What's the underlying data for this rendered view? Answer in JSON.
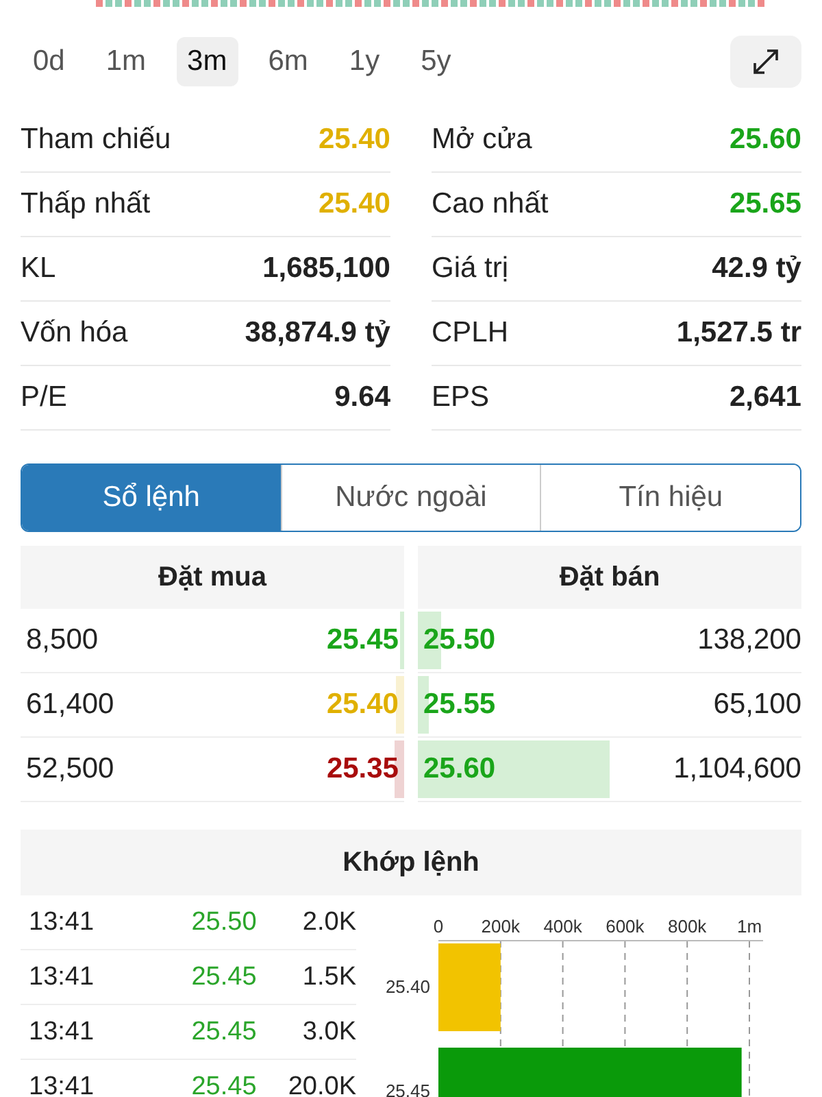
{
  "periods": [
    {
      "label": "0d",
      "selected": false
    },
    {
      "label": "1m",
      "selected": false
    },
    {
      "label": "3m",
      "selected": true
    },
    {
      "label": "6m",
      "selected": false
    },
    {
      "label": "1y",
      "selected": false
    },
    {
      "label": "5y",
      "selected": false
    }
  ],
  "stats": [
    {
      "label": "Tham chiếu",
      "value": "25.40",
      "color": "#e0b000"
    },
    {
      "label": "Mở cửa",
      "value": "25.60",
      "color": "#1aa51a"
    },
    {
      "label": "Thấp nhất",
      "value": "25.40",
      "color": "#e0b000"
    },
    {
      "label": "Cao nhất",
      "value": "25.65",
      "color": "#1aa51a"
    },
    {
      "label": "KL",
      "value": "1,685,100",
      "color": "#222222"
    },
    {
      "label": "Giá trị",
      "value": "42.9 tỷ",
      "color": "#222222"
    },
    {
      "label": "Vốn hóa",
      "value": "38,874.9 tỷ",
      "color": "#222222"
    },
    {
      "label": "CPLH",
      "value": "1,527.5 tr",
      "color": "#222222"
    },
    {
      "label": "P/E",
      "value": "9.64",
      "color": "#222222"
    },
    {
      "label": "EPS",
      "value": "2,641",
      "color": "#222222"
    }
  ],
  "tabs": [
    {
      "label": "Sổ lệnh",
      "selected": true
    },
    {
      "label": "Nước ngoài",
      "selected": false
    },
    {
      "label": "Tín hiệu",
      "selected": false
    }
  ],
  "order_book": {
    "bid_title": "Đặt mua",
    "ask_title": "Đặt bán",
    "rows": [
      {
        "bid": {
          "volume": "8,500",
          "price": "25.45",
          "color": "#1aa51a",
          "level": 0.01
        },
        "ask": {
          "price": "25.50",
          "color": "#1aa51a",
          "level": 0.06,
          "volume": "138,200"
        }
      },
      {
        "bid": {
          "volume": "61,400",
          "price": "25.40",
          "color": "#e0b000",
          "level": 0.02
        },
        "ask": {
          "price": "25.55",
          "color": "#1aa51a",
          "level": 0.03,
          "volume": "65,100"
        }
      },
      {
        "bid": {
          "volume": "52,500",
          "price": "25.35",
          "color": "#a80c0c",
          "level": 0.025
        },
        "ask": {
          "price": "25.60",
          "color": "#1aa51a",
          "level": 0.5,
          "volume": "1,104,600"
        }
      }
    ]
  },
  "matches": {
    "title": "Khớp lệnh",
    "rows": [
      {
        "time": "13:41",
        "price": "25.50",
        "volume": "2.0K",
        "color": "#2aa52a"
      },
      {
        "time": "13:41",
        "price": "25.45",
        "volume": "1.5K",
        "color": "#2aa52a"
      },
      {
        "time": "13:41",
        "price": "25.45",
        "volume": "3.0K",
        "color": "#2aa52a"
      },
      {
        "time": "13:41",
        "price": "25.45",
        "volume": "20.0K",
        "color": "#2aa52a"
      }
    ],
    "chart_data": {
      "type": "bar",
      "orientation": "horizontal",
      "grid": true,
      "categories": [
        "25.40",
        "25.45"
      ],
      "series": [
        {
          "color": "#f2c300",
          "values": [
            200000,
            null
          ]
        },
        {
          "color": "#0a9a0a",
          "values": [
            null,
            975000
          ]
        }
      ],
      "xlim": [
        0,
        1000000
      ],
      "xticks": [
        {
          "value": 0,
          "label": "0"
        },
        {
          "value": 200000,
          "label": "200k"
        },
        {
          "value": 400000,
          "label": "400k"
        },
        {
          "value": 600000,
          "label": "600k"
        },
        {
          "value": 800000,
          "label": "800k"
        },
        {
          "value": 1000000,
          "label": "1m"
        }
      ]
    }
  }
}
